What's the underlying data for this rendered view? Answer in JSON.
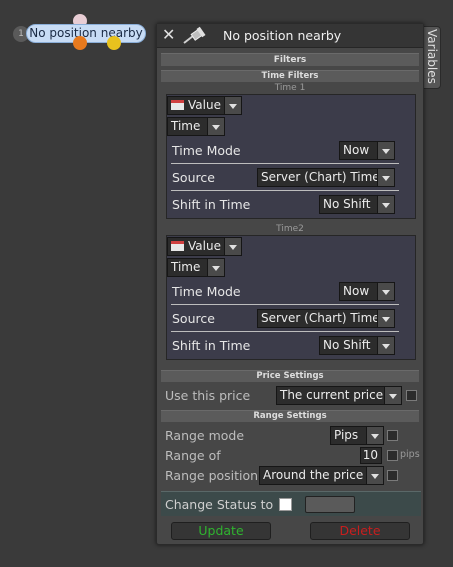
{
  "node": {
    "number": "1",
    "label": "No position nearby"
  },
  "dialog": {
    "title": "No position nearby",
    "side_tab": "Variables",
    "filters_header": "Filters",
    "time_filters_header": "Time Filters",
    "time1": {
      "label": "Time 1",
      "value_combo": "Value",
      "type_combo": "Time",
      "rows": [
        {
          "label": "Time Mode",
          "value": "Now"
        },
        {
          "label": "Source",
          "value": "Server (Chart) Time"
        },
        {
          "label": "Shift in Time",
          "value": "No Shift"
        }
      ]
    },
    "time2": {
      "label": "Time2",
      "value_combo": "Value",
      "type_combo": "Time",
      "rows": [
        {
          "label": "Time Mode",
          "value": "Now"
        },
        {
          "label": "Source",
          "value": "Server (Chart) Time"
        },
        {
          "label": "Shift in Time",
          "value": "No Shift"
        }
      ]
    },
    "price_settings": {
      "header": "Price Settings",
      "label": "Use this price",
      "value": "The current price"
    },
    "range_settings": {
      "header": "Range Settings",
      "mode_label": "Range mode",
      "mode_value": "Pips",
      "range_of_label": "Range of",
      "range_of_value": "10",
      "range_of_unit": "pips",
      "position_label": "Range position",
      "position_value": "Around the price"
    },
    "status": {
      "label": "Change Status to"
    },
    "buttons": {
      "update": "Update",
      "delete": "Delete"
    }
  },
  "colors": {
    "update": "#2fb42f",
    "delete": "#c81e1e",
    "node_pill": "#c8dcf5"
  }
}
